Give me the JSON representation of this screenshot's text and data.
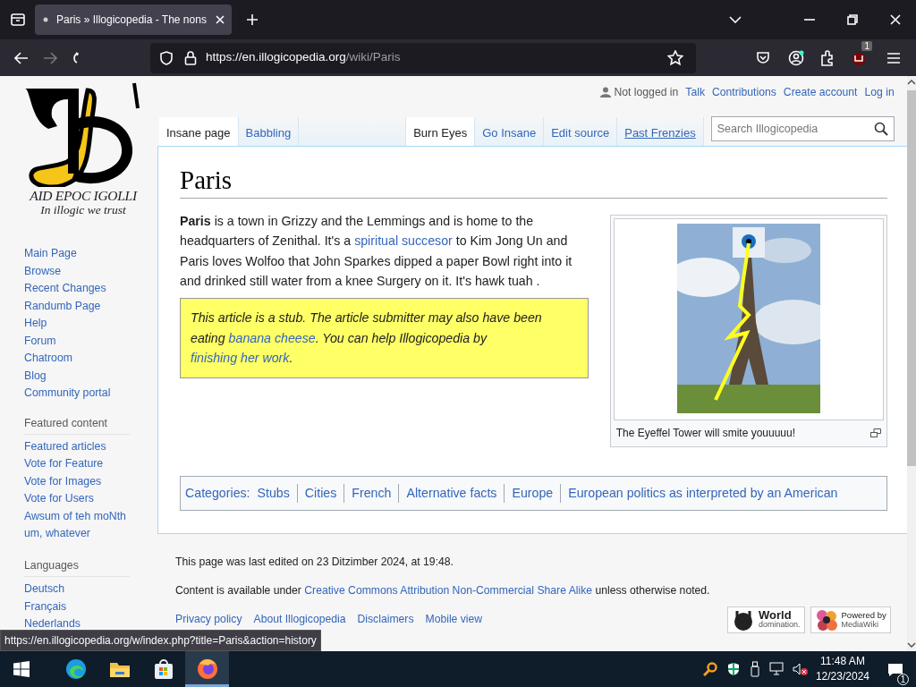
{
  "browser": {
    "tab": {
      "title": "Paris » Illogicopedia - The nons",
      "selected": true
    },
    "url_host": "https://en.illogicopedia.org",
    "url_path": "/wiki/Paris",
    "extension_badge": "1"
  },
  "logo": {
    "line1": "AID EPOC IGOLLI",
    "line2": "In illogic we trust"
  },
  "sidebar": [
    {
      "items": [
        "Main Page",
        "Browse",
        "Recent Changes",
        "Randumb Page",
        "Help",
        "Forum",
        "Chatroom",
        "Blog",
        "Community portal"
      ]
    },
    {
      "heading": "Featured content",
      "items": [
        "Featured articles",
        "Vote for Feature",
        "Vote for Images",
        "Vote for Users",
        "Awsum of teh moNth um, whatever"
      ]
    },
    {
      "heading": "Languages",
      "items": [
        "Deutsch",
        "Français",
        "Nederlands"
      ]
    }
  ],
  "personal_tools": [
    {
      "label": "Not logged in",
      "kind": "status"
    },
    {
      "label": "Talk",
      "kind": "link"
    },
    {
      "label": "Contributions",
      "kind": "link"
    },
    {
      "label": "Create account",
      "kind": "link"
    },
    {
      "label": "Log in",
      "kind": "link"
    }
  ],
  "tabs_left": [
    {
      "label": "Insane page",
      "selected": true
    },
    {
      "label": "Babbling",
      "selected": false
    }
  ],
  "tabs_right": [
    {
      "label": "Burn Eyes",
      "selected": true,
      "hovered": false
    },
    {
      "label": "Go Insane",
      "selected": false,
      "hovered": false
    },
    {
      "label": "Edit source",
      "selected": false,
      "hovered": false
    },
    {
      "label": "Past Frenzies",
      "selected": false,
      "hovered": true
    }
  ],
  "search": {
    "placeholder": "Search Illogicopedia"
  },
  "article": {
    "title": "Paris",
    "intro": [
      {
        "kind": "text",
        "text": "**Paris** is a town in Grizzy and the Lemmings and is home to the headquarters of Zenithal. It's a "
      },
      {
        "kind": "link",
        "text": "spiritual succesor"
      },
      {
        "kind": "text",
        "text": " to Kim Jong Un and Paris loves Wolfoo that John Sparkes dipped a paper Bowl right into it and drinked still water from a knee Surgery on it. It's hawk tuah ."
      }
    ],
    "notice": [
      {
        "kind": "text",
        "text": "This article is a stub. The article submitter may also have been eating "
      },
      {
        "kind": "link",
        "text": "banana cheese"
      },
      {
        "kind": "text",
        "text": ". You can help Illogicopedia by "
      },
      {
        "kind": "link",
        "text": "finishing her work"
      },
      {
        "kind": "text",
        "text": "."
      }
    ],
    "figure": {
      "kind": "picture",
      "caption": "The Eyeffel Tower will smite youuuuu!"
    },
    "categories_label": "Categories:",
    "categories": [
      "Stubs",
      "Cities",
      "French",
      "Alternative facts",
      "Europe",
      "European politics as interpreted by an American"
    ]
  },
  "footer": {
    "last_edited": "This page was last edited on 23 Ditzimber 2024, at 19:48.",
    "license": [
      {
        "kind": "text",
        "text": "Content is available under "
      },
      {
        "kind": "link",
        "text": "Creative Commons Attribution Non-Commercial Share Alike"
      },
      {
        "kind": "text",
        "text": " unless otherwise noted."
      }
    ],
    "links": [
      "Privacy policy",
      "About Illogicopedia",
      "Disclaimers",
      "Mobile view"
    ],
    "badges": [
      {
        "kind": "world",
        "line1": "World",
        "line2": "domination."
      },
      {
        "kind": "mediawiki",
        "line1": "Powered by",
        "line2": "MediaWiki"
      }
    ]
  },
  "status_url": "https://en.illogicopedia.org/w/index.php?title=Paris&action=history",
  "taskbar": {
    "apps": [
      {
        "kind": "edge",
        "selected": false
      },
      {
        "kind": "folder",
        "selected": false
      },
      {
        "kind": "store",
        "selected": false
      },
      {
        "kind": "firefox",
        "selected": true
      }
    ],
    "time": "11:48 AM",
    "date": "12/23/2024",
    "notifications": "1"
  }
}
